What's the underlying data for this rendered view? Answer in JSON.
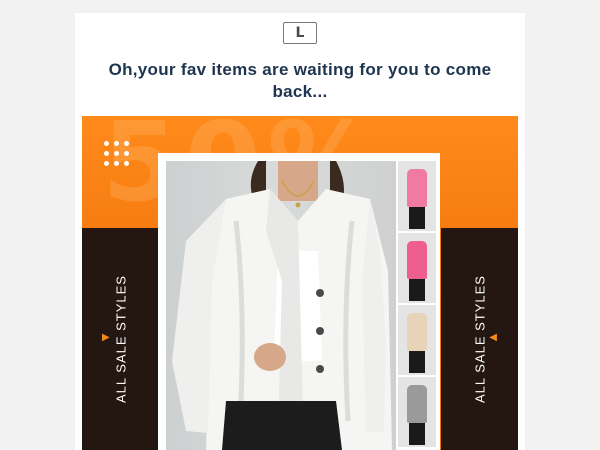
{
  "logo": {
    "letter": "L"
  },
  "headline": "Oh,your fav items are waiting for you to come back...",
  "banner": {
    "ghost_text": "50%",
    "left_label": "ALL SALE STYLES",
    "right_label": "ALL SALE STYLES",
    "left_arrow": "▶",
    "right_arrow": "◀",
    "accent_color": "#f57a10",
    "panel_color": "#241711"
  },
  "product": {
    "main_image": "model-white-blazer",
    "thumbnails": [
      {
        "name": "pink-blazer",
        "color": "#f07aa0"
      },
      {
        "name": "pink-blazer-alt",
        "color": "#ee5f90"
      },
      {
        "name": "beige-blazer",
        "color": "#e6d3b8"
      },
      {
        "name": "grey-blazer",
        "color": "#9a9a9a"
      }
    ]
  }
}
